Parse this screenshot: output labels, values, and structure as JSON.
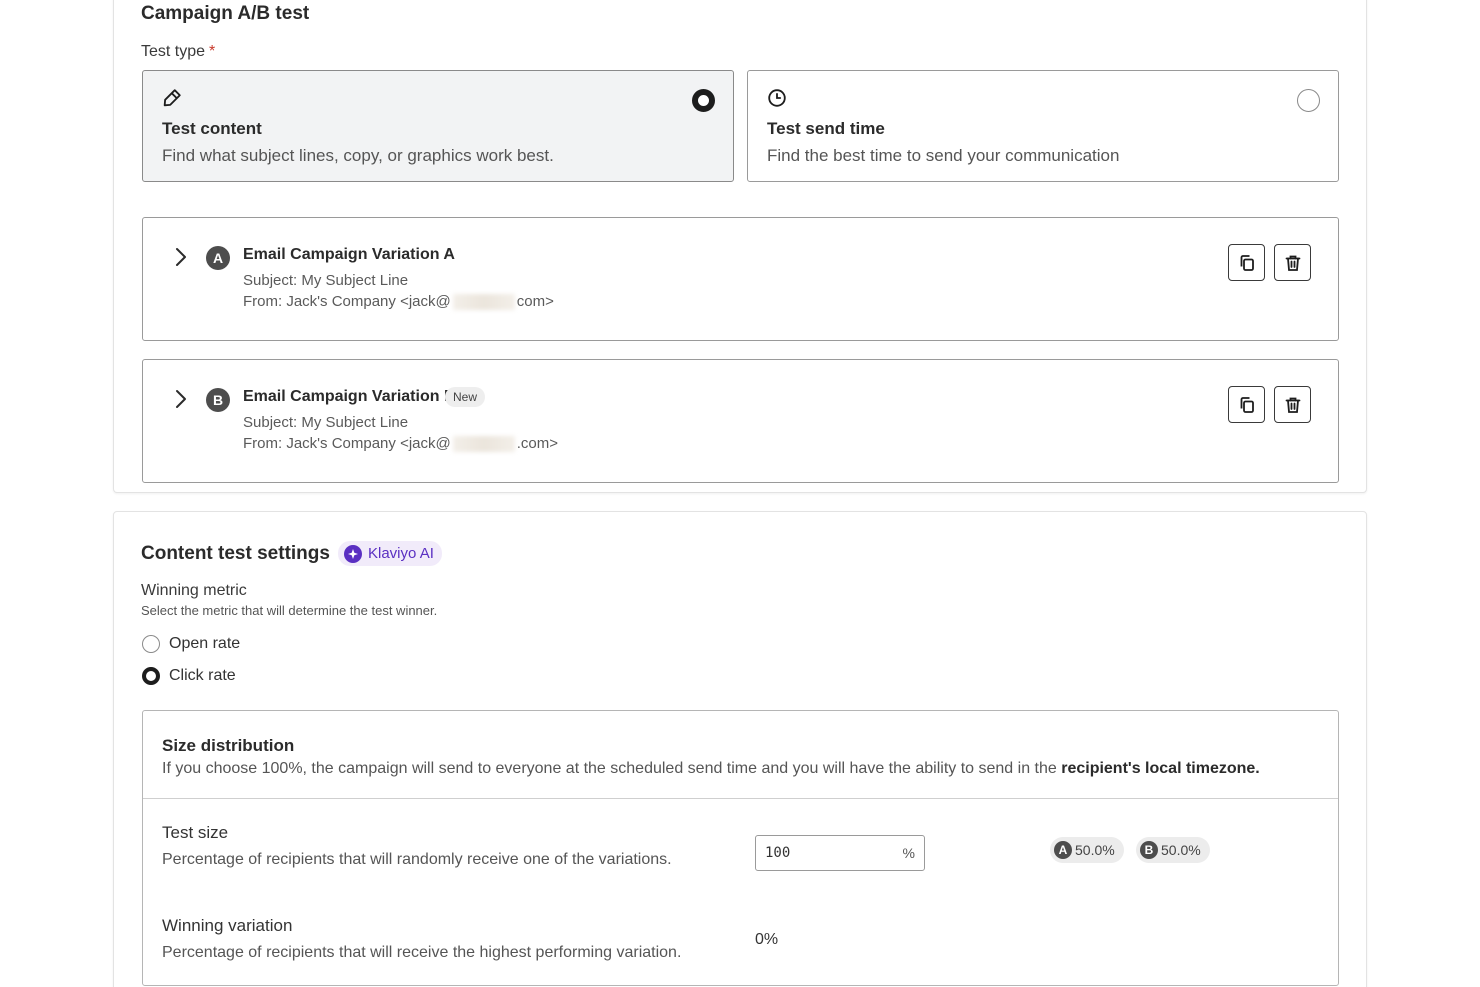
{
  "ab_test": {
    "title": "Campaign A/B test",
    "test_type_label": "Test type",
    "required_mark": "*",
    "options": [
      {
        "title": "Test content",
        "desc": "Find what subject lines, copy, or graphics work best.",
        "icon": "pencil-icon",
        "selected": true
      },
      {
        "title": "Test send time",
        "desc": "Find the best time to send your communication",
        "icon": "clock-icon",
        "selected": false
      }
    ],
    "variations": [
      {
        "badge": "A",
        "name": "Email Campaign Variation A",
        "subject": "Subject: My Subject Line",
        "from_prefix": "From: Jack's Company <jack@",
        "from_suffix": "com>",
        "tag": ""
      },
      {
        "badge": "B",
        "name": "Email Campaign Variation B",
        "subject": "Subject: My Subject Line",
        "from_prefix": "From: Jack's Company <jack@",
        "from_suffix": ".com>",
        "tag": "New"
      }
    ]
  },
  "settings": {
    "title": "Content test settings",
    "ai_badge": "Klaviyo AI",
    "winning_metric_label": "Winning metric",
    "winning_metric_help": "Select the metric that will determine the test winner.",
    "metrics": [
      {
        "label": "Open rate",
        "checked": false
      },
      {
        "label": "Click rate",
        "checked": true
      }
    ],
    "size": {
      "title": "Size distribution",
      "desc_prefix": "If you choose 100%, the campaign will send to everyone at the scheduled send time and you will have the ability to send in the ",
      "desc_bold": "recipient's local timezone.",
      "test_size_label": "Test size",
      "test_size_desc": "Percentage of recipients that will randomly receive one of the variations.",
      "test_size_value": "100",
      "pct_sign": "%",
      "splits": [
        {
          "badge": "A",
          "value": "50.0%"
        },
        {
          "badge": "B",
          "value": "50.0%"
        }
      ],
      "winning_label": "Winning variation",
      "winning_desc": "Percentage of recipients that will receive the highest performing variation.",
      "winning_value": "0%"
    }
  },
  "colors": {
    "accent_purple": "#5a2fc2",
    "ai_badge_bg": "#f1ebfa",
    "badge_dark": "#4d4d4d",
    "selected_bg": "#f2f3f4"
  }
}
